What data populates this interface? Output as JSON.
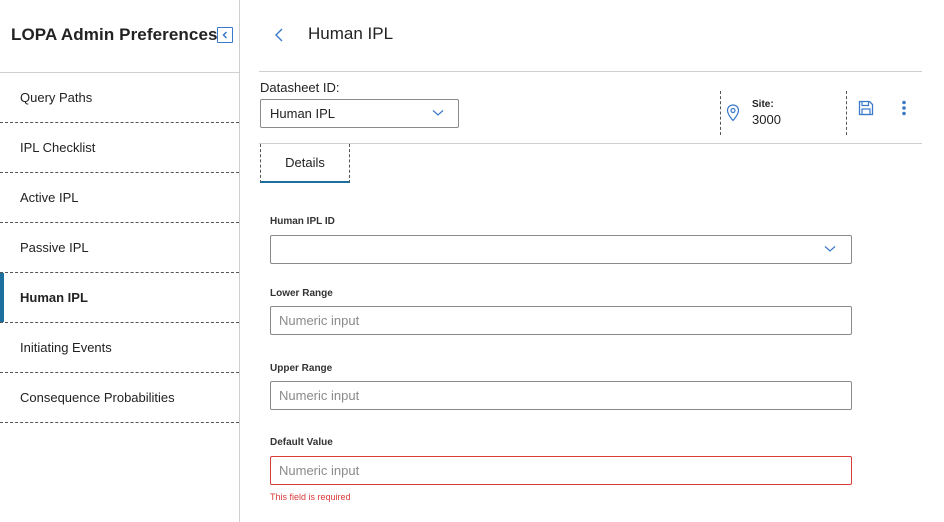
{
  "sidebar": {
    "title": "LOPA Admin Preferences",
    "items": [
      {
        "label": "Query Paths"
      },
      {
        "label": "IPL Checklist"
      },
      {
        "label": "Active IPL"
      },
      {
        "label": "Passive IPL"
      },
      {
        "label": "Human IPL"
      },
      {
        "label": "Initiating Events"
      },
      {
        "label": "Consequence Probabilities"
      }
    ],
    "active_item": "Human IPL"
  },
  "header": {
    "title": "Human IPL"
  },
  "datasheet": {
    "label": "Datasheet ID:",
    "selected": "Human IPL"
  },
  "site": {
    "label": "Site:",
    "value": "3000"
  },
  "tabs": [
    {
      "label": "Details",
      "active": true
    }
  ],
  "form": {
    "human_ipl_id": {
      "label": "Human IPL ID",
      "value": ""
    },
    "lower_range": {
      "label": "Lower Range",
      "placeholder": "Numeric input",
      "value": ""
    },
    "upper_range": {
      "label": "Upper Range",
      "placeholder": "Numeric input",
      "value": ""
    },
    "default_value": {
      "label": "Default Value",
      "placeholder": "Numeric input",
      "value": "",
      "error": "This field is required"
    }
  },
  "colors": {
    "accent": "#1d6f9e",
    "icon_blue": "#3a78c9",
    "error": "#d93a3a"
  },
  "icons": {
    "collapse": "collapse-sidebar-icon",
    "back": "chevron-left-icon",
    "dropdown": "chevron-down-icon",
    "site": "location-pin-icon",
    "save": "save-icon",
    "more": "more-vertical-icon"
  }
}
